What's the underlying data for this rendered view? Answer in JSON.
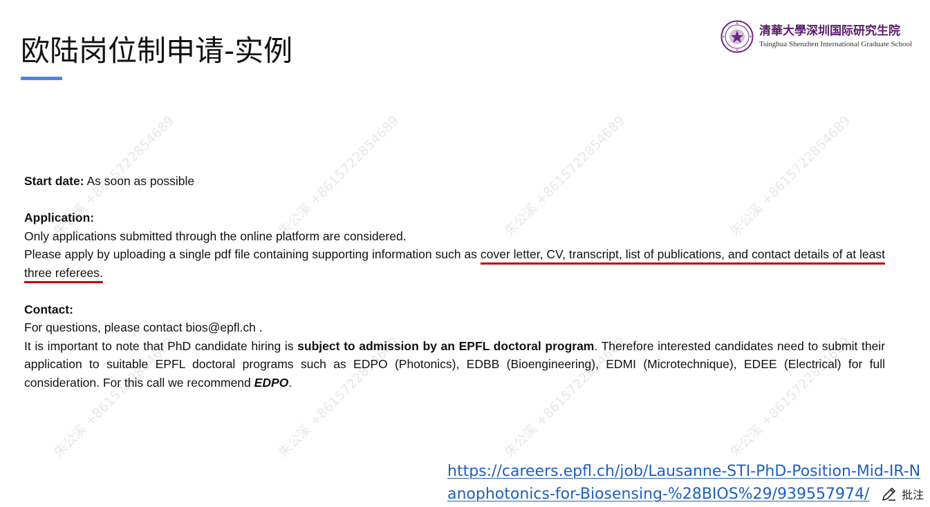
{
  "slide": {
    "title": "欧陆岗位制申请-实例",
    "accent_color": "#4a86e8"
  },
  "logo": {
    "emblem_icon": "tsinghua-seal-icon",
    "name_cn": "清華大學深圳国际研究生院",
    "name_en": "Tsinghua Shenzhen International Graduate School"
  },
  "watermark": {
    "text": "朱公溪 +8615722854689"
  },
  "posting": {
    "start_date_label": "Start date:",
    "start_date_value": " As soon as possible",
    "application_heading": "Application:",
    "application_line1": "Only applications submitted through the online platform are considered.",
    "application_line2_pre": "Please apply by uploading a single pdf file containing supporting information such as ",
    "application_line2_underlined": "cover letter, CV, transcript, list of publications, and contact details of at least three referees.",
    "underline_color": "#c00000",
    "contact_heading": "Contact:",
    "contact_line1": "For questions, please contact bios@epfl.ch .",
    "contact_line2_pre": "It is important to note that PhD candidate hiring is ",
    "contact_line2_bold": "subject to admission by an EPFL doctoral program",
    "contact_line2_post": ". Therefore interested candidates need to submit their application to suitable EPFL doctoral programs such as EDPO (Photonics), EDBB (Bioengineering), EDMI (Microtechnique), EDEE (Electrical) for full consideration. For this call we recommend ",
    "contact_line2_emph": "EDPO",
    "contact_line2_end": "."
  },
  "link": {
    "url": "https://careers.epfl.ch/job/Lausanne-STI-PhD-Position-Mid-IR-Nanophotonics-for-Biosensing-%28BIOS%29/939557974/",
    "color": "#1f5fbf"
  },
  "annotation": {
    "icon": "pencil-icon",
    "label": "批注"
  }
}
